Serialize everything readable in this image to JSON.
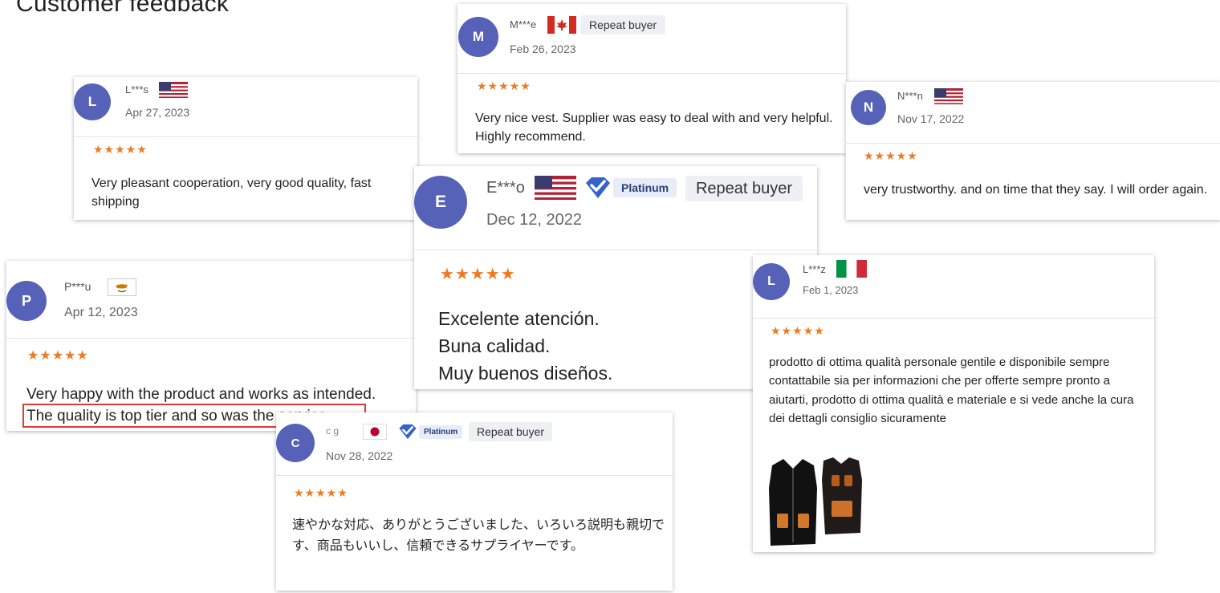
{
  "page": {
    "title": "Customer feedback"
  },
  "icons": {
    "star": "star-icon",
    "platinum": "platinum-diamond-icon"
  },
  "colors": {
    "avatar": "#5661b8",
    "stars": "#ee7a22",
    "highlight": "#e03a3a",
    "platinum_text": "#2a3f7d"
  },
  "reviews": [
    {
      "id": "mote",
      "initial": "M",
      "name": "M***e",
      "country_flag": "Canada",
      "badge": "Repeat buyer",
      "date": "Feb 26, 2023",
      "stars": "★★★★★",
      "text": "Very nice vest. Supplier was easy to deal with and very helpful. Highly recommend."
    },
    {
      "id": "lots",
      "initial": "L",
      "name": "L***s",
      "country_flag": "USA",
      "date": "Apr 27, 2023",
      "stars": "★★★★★",
      "text": "Very pleasant cooperation, very good quality, fast shipping"
    },
    {
      "id": "nn",
      "initial": "N",
      "name": "N***n",
      "country_flag": "USA",
      "date": "Nov 17, 2022",
      "stars": "★★★★★",
      "text": "very trustworthy. and on time that they say. I will order again."
    },
    {
      "id": "eo",
      "initial": "E",
      "name": "E***o",
      "country_flag": "USA",
      "platinum": "Platinum",
      "badge": "Repeat buyer",
      "date": "Dec 12, 2022",
      "stars": "★★★★★",
      "lines": [
        "Excelente atención.",
        "Buna calidad.",
        "Muy buenos diseños."
      ]
    },
    {
      "id": "pu",
      "initial": "P",
      "name": "P***u",
      "country_flag": "Cyprus",
      "date": "Apr 12, 2023",
      "stars": "★★★★★",
      "line1": "Very happy with the product and works as intended.",
      "line2": "The quality is top tier and so was the service."
    },
    {
      "id": "lz",
      "initial": "L",
      "name": "L***z",
      "country_flag": "Italy",
      "date": "Feb 1, 2023",
      "stars": "★★★★★",
      "text": "prodotto di ottima qualità personale gentile e disponibile sempre contattabile sia per informazioni che per offerte sempre pronto a aiutarti, prodotto di ottima qualità e materiale e si vede anche la cura dei dettagli consiglio sicuramente"
    },
    {
      "id": "cg",
      "initial": "C",
      "name": "c   g",
      "country_flag": "Japan",
      "platinum": "Platinum",
      "badge": "Repeat buyer",
      "date": "Nov 28, 2022",
      "stars": "★★★★★",
      "text": "速やかな対応、ありがとうございました、いろいろ説明も親切です、商品もいいし、信頼できるサプライヤーです。"
    }
  ]
}
